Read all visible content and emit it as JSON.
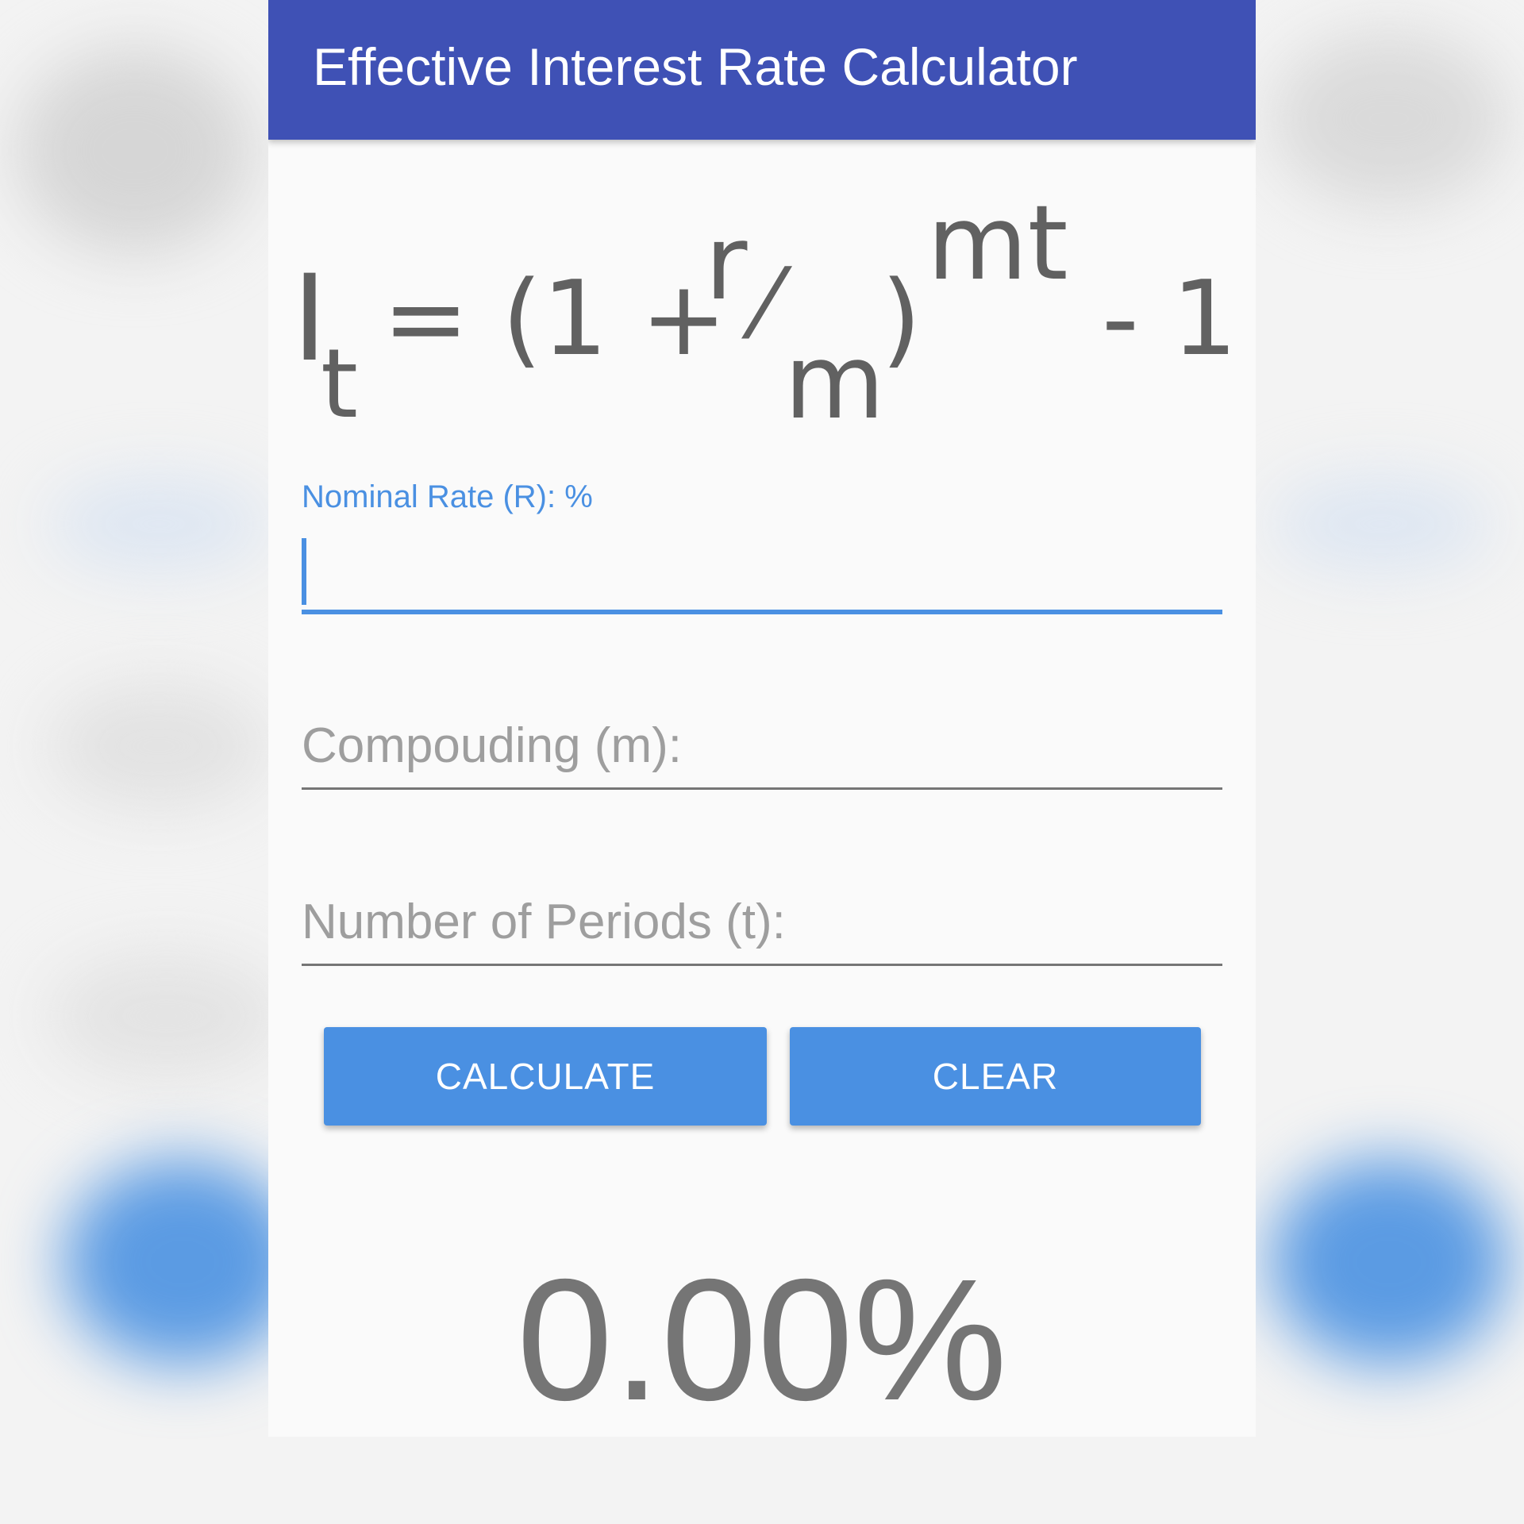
{
  "app_bar": {
    "title": "Effective Interest Rate Calculator",
    "color": "#3f51b5"
  },
  "formula": {
    "base": "I",
    "base_sub": "t",
    "equals_open": "= (1 +",
    "numerator": "r",
    "slash": "⁄",
    "denominator": "m",
    "close": ")",
    "exponent": "mt",
    "minus_one": "- 1"
  },
  "fields": {
    "nominal_rate": {
      "label": "Nominal Rate (R): %",
      "value": "",
      "accent": "#4a90e2"
    },
    "compounding": {
      "placeholder": "Compouding (m):",
      "value": ""
    },
    "periods": {
      "placeholder": "Number of Periods (t):",
      "value": ""
    }
  },
  "buttons": {
    "calculate": "CALCULATE",
    "clear": "CLEAR"
  },
  "result": {
    "value": "0.00%"
  }
}
